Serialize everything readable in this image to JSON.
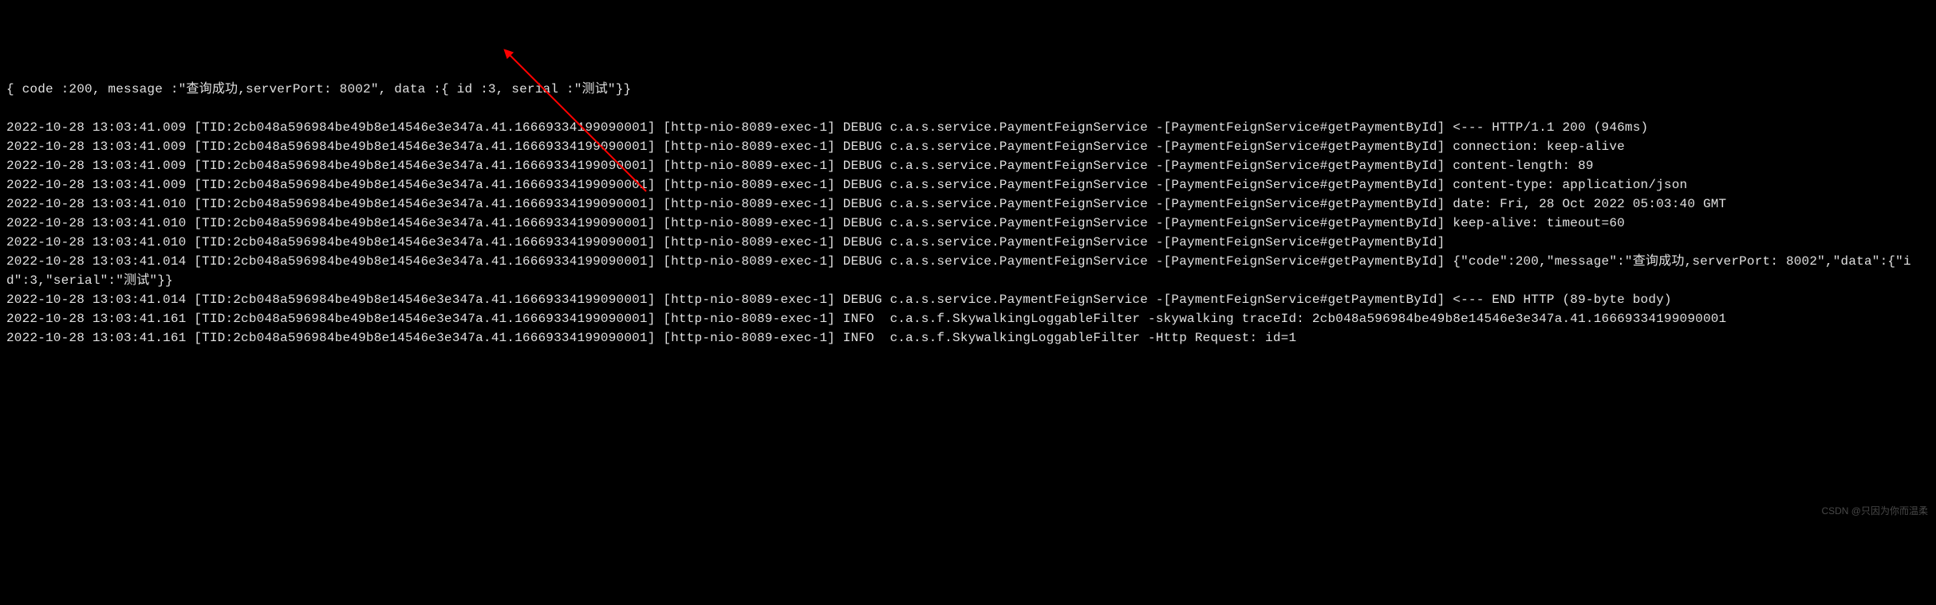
{
  "log_lines": [
    "{ code :200, message :\"查询成功,serverPort: 8002\", data :{ id :3, serial :\"测试\"}}",
    "",
    "2022-10-28 13:03:41.009 [TID:2cb048a596984be49b8e14546e3e347a.41.16669334199090001] [http-nio-8089-exec-1] DEBUG c.a.s.service.PaymentFeignService -[PaymentFeignService#getPaymentById] <--- HTTP/1.1 200 (946ms)",
    "2022-10-28 13:03:41.009 [TID:2cb048a596984be49b8e14546e3e347a.41.16669334199090001] [http-nio-8089-exec-1] DEBUG c.a.s.service.PaymentFeignService -[PaymentFeignService#getPaymentById] connection: keep-alive",
    "2022-10-28 13:03:41.009 [TID:2cb048a596984be49b8e14546e3e347a.41.16669334199090001] [http-nio-8089-exec-1] DEBUG c.a.s.service.PaymentFeignService -[PaymentFeignService#getPaymentById] content-length: 89",
    "2022-10-28 13:03:41.009 [TID:2cb048a596984be49b8e14546e3e347a.41.16669334199090001] [http-nio-8089-exec-1] DEBUG c.a.s.service.PaymentFeignService -[PaymentFeignService#getPaymentById] content-type: application/json",
    "2022-10-28 13:03:41.010 [TID:2cb048a596984be49b8e14546e3e347a.41.16669334199090001] [http-nio-8089-exec-1] DEBUG c.a.s.service.PaymentFeignService -[PaymentFeignService#getPaymentById] date: Fri, 28 Oct 2022 05:03:40 GMT",
    "2022-10-28 13:03:41.010 [TID:2cb048a596984be49b8e14546e3e347a.41.16669334199090001] [http-nio-8089-exec-1] DEBUG c.a.s.service.PaymentFeignService -[PaymentFeignService#getPaymentById] keep-alive: timeout=60",
    "2022-10-28 13:03:41.010 [TID:2cb048a596984be49b8e14546e3e347a.41.16669334199090001] [http-nio-8089-exec-1] DEBUG c.a.s.service.PaymentFeignService -[PaymentFeignService#getPaymentById]",
    "2022-10-28 13:03:41.014 [TID:2cb048a596984be49b8e14546e3e347a.41.16669334199090001] [http-nio-8089-exec-1] DEBUG c.a.s.service.PaymentFeignService -[PaymentFeignService#getPaymentById] {\"code\":200,\"message\":\"查询成功,serverPort: 8002\",\"data\":{\"id\":3,\"serial\":\"测试\"}}",
    "2022-10-28 13:03:41.014 [TID:2cb048a596984be49b8e14546e3e347a.41.16669334199090001] [http-nio-8089-exec-1] DEBUG c.a.s.service.PaymentFeignService -[PaymentFeignService#getPaymentById] <--- END HTTP (89-byte body)",
    "2022-10-28 13:03:41.161 [TID:2cb048a596984be49b8e14546e3e347a.41.16669334199090001] [http-nio-8089-exec-1] INFO  c.a.s.f.SkywalkingLoggableFilter -skywalking traceId: 2cb048a596984be49b8e14546e3e347a.41.16669334199090001",
    "2022-10-28 13:03:41.161 [TID:2cb048a596984be49b8e14546e3e347a.41.16669334199090001] [http-nio-8089-exec-1] INFO  c.a.s.f.SkywalkingLoggableFilter -Http Request: id=1"
  ],
  "watermark": "CSDN @只因为你而温柔",
  "arrow": {
    "color": "#ff0000"
  }
}
